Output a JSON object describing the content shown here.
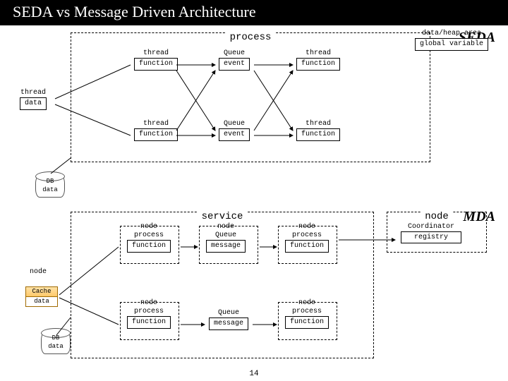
{
  "title": "SEDA vs Message Driven Architecture",
  "labels": {
    "seda": "SEDA",
    "mda": "MDA"
  },
  "seda": {
    "container": "process",
    "heap": {
      "top": "data/heap area",
      "pill": "global variable"
    },
    "row1": {
      "a": {
        "t": "thread",
        "p": "function"
      },
      "b": {
        "t": "Queue",
        "p": "event"
      },
      "c": {
        "t": "thread",
        "p": "function"
      }
    },
    "row2": {
      "a": {
        "t": "thread",
        "p": "function"
      },
      "b": {
        "t": "Queue",
        "p": "event"
      },
      "c": {
        "t": "thread",
        "p": "function"
      }
    },
    "threadData": {
      "top": "thread",
      "pill": "data"
    },
    "db": {
      "top": "DB",
      "bottom": "data"
    }
  },
  "mda": {
    "container": "service",
    "nodeSide": "node",
    "coord": {
      "top": "Coordinator",
      "pill": "registry"
    },
    "row1": {
      "a": {
        "t": "node",
        "mid": "process",
        "p": "function"
      },
      "b": {
        "t": "node",
        "mid": "Queue",
        "p": "message"
      },
      "c": {
        "t": "node",
        "mid": "process",
        "p": "function"
      }
    },
    "row2": {
      "a": {
        "t": "node",
        "mid": "process",
        "p": "function"
      },
      "b": {
        "mid": "Queue",
        "p": "message"
      },
      "c": {
        "t": "node",
        "mid": "process",
        "p": "function"
      }
    },
    "leftNode": "node",
    "cache": {
      "top": "Cache",
      "bottom": "data"
    },
    "db": {
      "top": "DB",
      "bottom": "data"
    }
  },
  "page": "14"
}
